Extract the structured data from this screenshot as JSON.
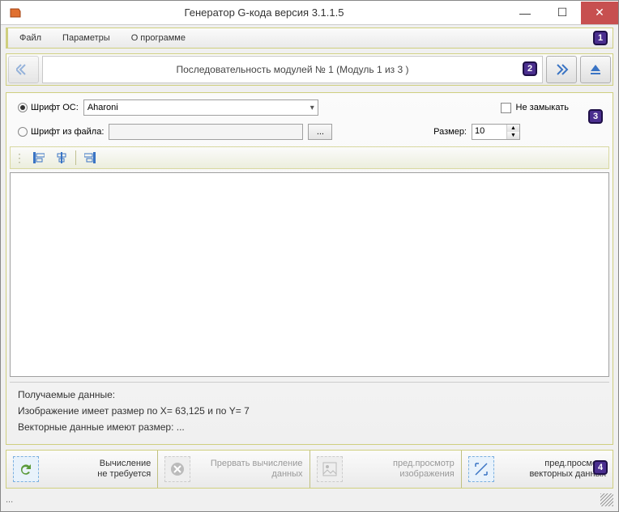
{
  "titlebar": {
    "title": "Генератор G-кода версия 3.1.1.5"
  },
  "menu": {
    "file": "Файл",
    "params": "Параметры",
    "about": "О программе"
  },
  "badges": {
    "b1": "1",
    "b2": "2",
    "b3": "3",
    "b4": "4"
  },
  "module": {
    "label": "Последовательность модулей № 1 (Модуль 1 из 3 )"
  },
  "font": {
    "os_label": "Шрифт ОС:",
    "os_value": "Aharoni",
    "file_label": "Шрифт из файла:",
    "browse": "...",
    "no_close": "Не замыкать",
    "size_label": "Размер:",
    "size_value": "10"
  },
  "info": {
    "header": "Получаемые данные:",
    "line1": "Изображение имеет размер по X= 63,125 и по Y= 7",
    "line2": "Векторные данные имеют размер:  ..."
  },
  "bottom": {
    "calc1": "Вычисление",
    "calc2": "не требуется",
    "abort1": "Прервать вычисление",
    "abort2": "данных",
    "prev_img1": "пред.просмотр",
    "prev_img2": "изображения",
    "prev_vec1": "пред.просмотр",
    "prev_vec2": "векторных данных"
  },
  "status": {
    "left": "..."
  }
}
